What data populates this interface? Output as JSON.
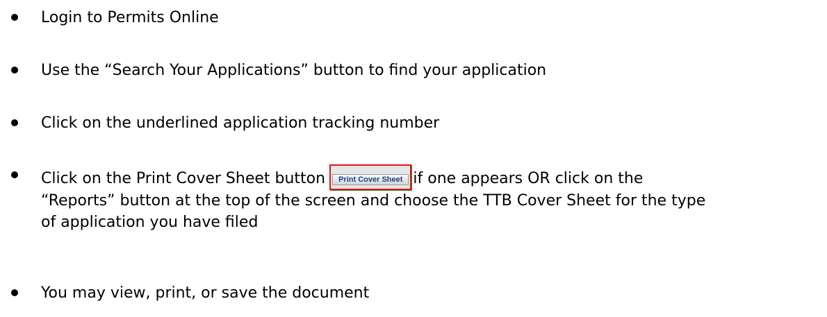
{
  "steps": [
    {
      "text": "Login to Permits Online"
    },
    {
      "text": "Use the “Search Your Applications” button to find your application"
    },
    {
      "text": "Click on the underlined application tracking number"
    },
    {
      "before_button": "Click on the Print Cover Sheet button",
      "button_label": "Print Cover Sheet",
      "after_button": "if one appears OR click on the",
      "line2": "“Reports” button at the top of the screen and choose the TTB Cover Sheet for the type",
      "line3": "of application you have filed"
    },
    {
      "text": "You may view, print, or save the document"
    }
  ],
  "colors": {
    "button_border": "#e0141c",
    "button_text": "#1a3f8f"
  }
}
